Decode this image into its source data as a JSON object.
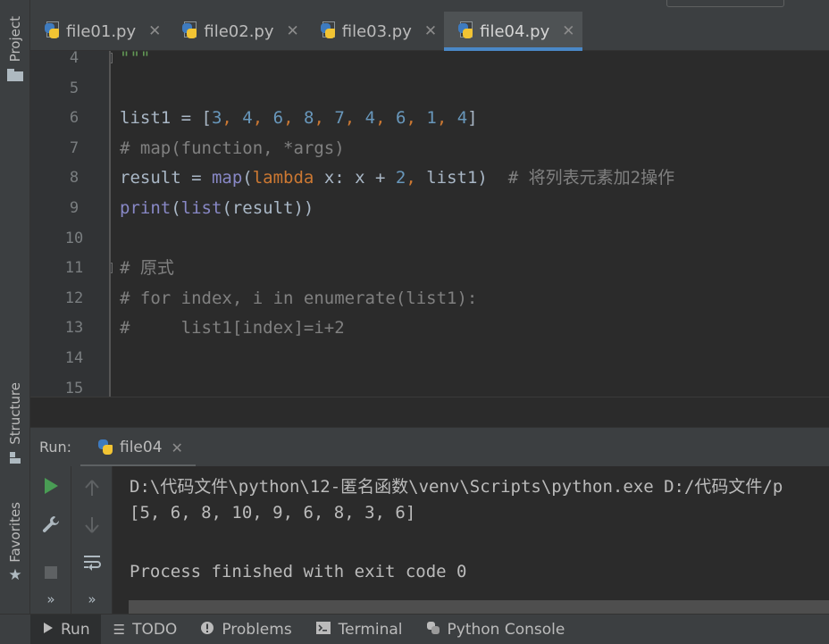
{
  "left_strip": {
    "project_label": "Project",
    "structure_label": "Structure",
    "favorites_label": "Favorites"
  },
  "tabs": [
    {
      "label": "file01.py",
      "active": false
    },
    {
      "label": "file02.py",
      "active": false
    },
    {
      "label": "file03.py",
      "active": false
    },
    {
      "label": "file04.py",
      "active": true
    }
  ],
  "editor": {
    "lines": [
      {
        "n": "4",
        "tokens": [
          {
            "t": "\"\"\"",
            "c": "t-str"
          }
        ],
        "fold": true
      },
      {
        "n": "5",
        "tokens": []
      },
      {
        "n": "6",
        "tokens": [
          {
            "t": "list1 = [",
            "c": "t-var"
          },
          {
            "t": "3",
            "c": "t-num"
          },
          {
            "t": ", ",
            "c": "t-pun"
          },
          {
            "t": "4",
            "c": "t-num"
          },
          {
            "t": ", ",
            "c": "t-pun"
          },
          {
            "t": "6",
            "c": "t-num"
          },
          {
            "t": ", ",
            "c": "t-pun"
          },
          {
            "t": "8",
            "c": "t-num"
          },
          {
            "t": ", ",
            "c": "t-pun"
          },
          {
            "t": "7",
            "c": "t-num"
          },
          {
            "t": ", ",
            "c": "t-pun"
          },
          {
            "t": "4",
            "c": "t-num"
          },
          {
            "t": ", ",
            "c": "t-pun"
          },
          {
            "t": "6",
            "c": "t-num"
          },
          {
            "t": ", ",
            "c": "t-pun"
          },
          {
            "t": "1",
            "c": "t-num"
          },
          {
            "t": ", ",
            "c": "t-pun"
          },
          {
            "t": "4",
            "c": "t-num"
          },
          {
            "t": "]",
            "c": "t-var"
          }
        ]
      },
      {
        "n": "7",
        "tokens": [
          {
            "t": "# map(function, *args)",
            "c": "t-com"
          }
        ]
      },
      {
        "n": "8",
        "tokens": [
          {
            "t": "result = ",
            "c": "t-var"
          },
          {
            "t": "map",
            "c": "t-bi"
          },
          {
            "t": "(",
            "c": "t-var"
          },
          {
            "t": "lambda",
            "c": "t-kw"
          },
          {
            "t": " x: x + ",
            "c": "t-var"
          },
          {
            "t": "2",
            "c": "t-num"
          },
          {
            "t": ", ",
            "c": "t-pun"
          },
          {
            "t": "list1)  ",
            "c": "t-var"
          },
          {
            "t": "# 将列表元素加2操作",
            "c": "t-com"
          }
        ]
      },
      {
        "n": "9",
        "tokens": [
          {
            "t": "print",
            "c": "t-bi"
          },
          {
            "t": "(",
            "c": "t-var"
          },
          {
            "t": "list",
            "c": "t-bi"
          },
          {
            "t": "(result))",
            "c": "t-var"
          }
        ]
      },
      {
        "n": "10",
        "tokens": []
      },
      {
        "n": "11",
        "tokens": [
          {
            "t": "# 原式",
            "c": "t-com"
          }
        ],
        "fold": true
      },
      {
        "n": "12",
        "tokens": [
          {
            "t": "# for index, i in enumerate(list1):",
            "c": "t-com"
          }
        ]
      },
      {
        "n": "13",
        "tokens": [
          {
            "t": "#     list1[index]=i+2",
            "c": "t-com"
          }
        ]
      },
      {
        "n": "14",
        "tokens": []
      },
      {
        "n": "15",
        "tokens": []
      }
    ]
  },
  "run_panel": {
    "run_label": "Run:",
    "tab_label": "file04",
    "console_lines": [
      "D:\\代码文件\\python\\12-匿名函数\\venv\\Scripts\\python.exe D:/代码文件/p",
      "[5, 6, 8, 10, 9, 6, 8, 3, 6]",
      "",
      "Process finished with exit code 0"
    ]
  },
  "bottom_bar": [
    {
      "label": "Run",
      "icon": "play-icon",
      "active": true
    },
    {
      "label": "TODO",
      "icon": "list-icon",
      "active": false
    },
    {
      "label": "Problems",
      "icon": "info-icon",
      "active": false
    },
    {
      "label": "Terminal",
      "icon": "terminal-icon",
      "active": false
    },
    {
      "label": "Python Console",
      "icon": "python-icon",
      "active": false
    }
  ],
  "colors": {
    "accent": "#4a88c7",
    "run_green": "#499c54",
    "number": "#6897bb",
    "keyword": "#cc7832",
    "comment": "#808080",
    "builtin": "#8888c6"
  }
}
